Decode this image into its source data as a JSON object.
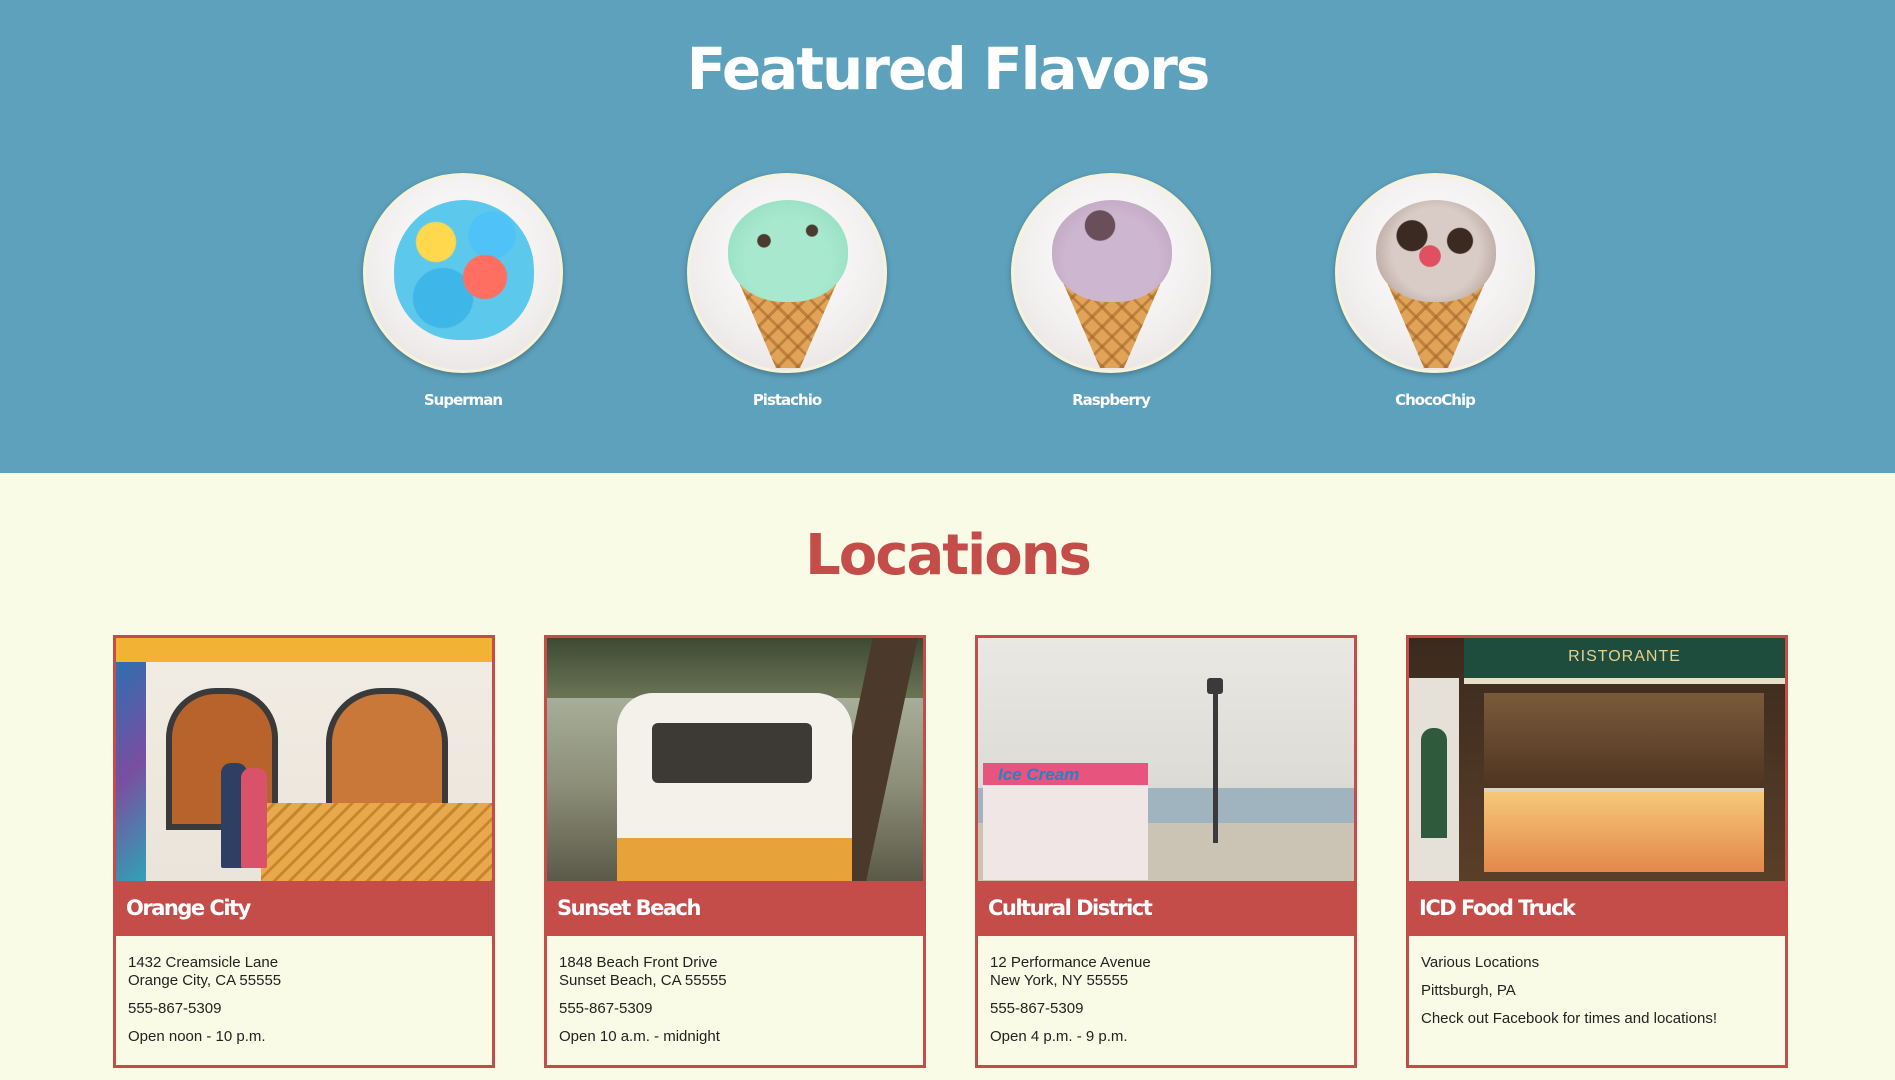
{
  "featured": {
    "title": "Featured Flavors",
    "flavors": [
      {
        "name": "Superman",
        "icon": "superman-ice-cream-photo"
      },
      {
        "name": "Pistachio",
        "icon": "pistachio-ice-cream-photo"
      },
      {
        "name": "Raspberry",
        "icon": "raspberry-ice-cream-photo"
      },
      {
        "name": "ChocoChip",
        "icon": "chocochip-ice-cream-photo"
      }
    ]
  },
  "locations": {
    "title": "Locations",
    "cards": [
      {
        "name": "Orange City",
        "address1": "1432 Creamsicle Lane",
        "address2": "Orange City, CA 55555",
        "phone": "555-867-5309",
        "hours": "Open noon - 10 p.m."
      },
      {
        "name": "Sunset Beach",
        "address1": "1848 Beach Front Drive",
        "address2": "Sunset Beach, CA 55555",
        "phone": "555-867-5309",
        "hours": "Open 10 a.m. - midnight"
      },
      {
        "name": "Cultural District",
        "address1": "12 Performance Avenue",
        "address2": "New York, NY 55555",
        "phone": "555-867-5309",
        "hours": "Open 4 p.m. - 9 p.m."
      },
      {
        "name": "ICD Food Truck",
        "line1": "Various Locations",
        "line2": "Pittsburgh, PA",
        "line3": "Check out Facebook for times and locations!"
      }
    ],
    "photo_signs": {
      "ristorante": "RISTORANTE",
      "ice_cream": "Ice Cream"
    }
  },
  "colors": {
    "featured_bg": "#5ea1bc",
    "page_bg": "#fafbe6",
    "accent": "#c44d4a"
  }
}
